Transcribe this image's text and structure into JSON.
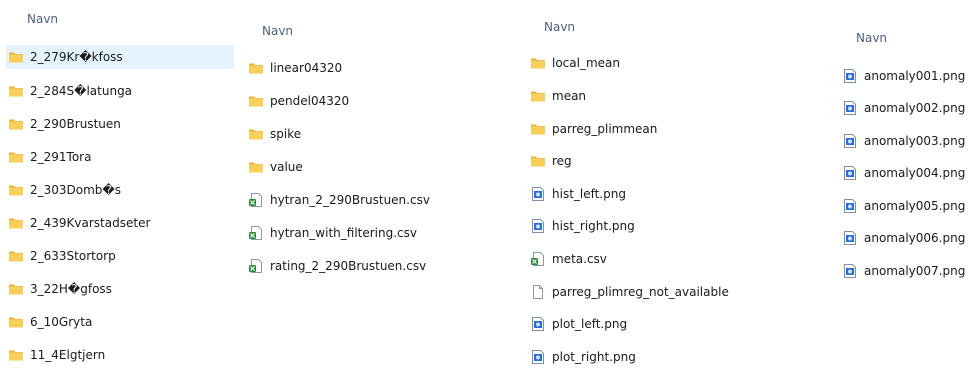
{
  "columns": [
    {
      "header": "Navn",
      "items": [
        {
          "label": "2_279Kr�kfoss",
          "icon": "folder-icon",
          "selected": true
        },
        {
          "label": "2_284S�latunga",
          "icon": "folder-icon"
        },
        {
          "label": "2_290Brustuen",
          "icon": "folder-icon"
        },
        {
          "label": "2_291Tora",
          "icon": "folder-icon"
        },
        {
          "label": "2_303Domb�s",
          "icon": "folder-icon"
        },
        {
          "label": "2_439Kvarstadseter",
          "icon": "folder-icon"
        },
        {
          "label": "2_633Stortorp",
          "icon": "folder-icon"
        },
        {
          "label": "3_22H�gfoss",
          "icon": "folder-icon"
        },
        {
          "label": "6_10Gryta",
          "icon": "folder-icon"
        },
        {
          "label": "11_4Elgtjern",
          "icon": "folder-icon"
        }
      ]
    },
    {
      "header": "Navn",
      "items": [
        {
          "label": "linear04320",
          "icon": "folder-icon"
        },
        {
          "label": "pendel04320",
          "icon": "folder-icon"
        },
        {
          "label": "spike",
          "icon": "folder-icon"
        },
        {
          "label": "value",
          "icon": "folder-icon"
        },
        {
          "label": "hytran_2_290Brustuen.csv",
          "icon": "csv-file-icon"
        },
        {
          "label": "hytran_with_filtering.csv",
          "icon": "csv-file-icon"
        },
        {
          "label": "rating_2_290Brustuen.csv",
          "icon": "csv-file-icon"
        }
      ]
    },
    {
      "header": "Navn",
      "items": [
        {
          "label": "local_mean",
          "icon": "folder-icon"
        },
        {
          "label": "mean",
          "icon": "folder-icon"
        },
        {
          "label": "parreg_plimmean",
          "icon": "folder-icon"
        },
        {
          "label": "reg",
          "icon": "folder-icon"
        },
        {
          "label": "hist_left.png",
          "icon": "png-file-icon"
        },
        {
          "label": "hist_right.png",
          "icon": "png-file-icon"
        },
        {
          "label": "meta.csv",
          "icon": "csv-file-icon"
        },
        {
          "label": "parreg_plimreg_not_available",
          "icon": "blank-file-icon"
        },
        {
          "label": "plot_left.png",
          "icon": "png-file-icon"
        },
        {
          "label": "plot_right.png",
          "icon": "png-file-icon"
        }
      ]
    },
    {
      "header": "Navn",
      "items": [
        {
          "label": "anomaly001.png",
          "icon": "png-file-icon"
        },
        {
          "label": "anomaly002.png",
          "icon": "png-file-icon"
        },
        {
          "label": "anomaly003.png",
          "icon": "png-file-icon"
        },
        {
          "label": "anomaly004.png",
          "icon": "png-file-icon"
        },
        {
          "label": "anomaly005.png",
          "icon": "png-file-icon"
        },
        {
          "label": "anomaly006.png",
          "icon": "png-file-icon"
        },
        {
          "label": "anomaly007.png",
          "icon": "png-file-icon"
        }
      ]
    }
  ],
  "colors": {
    "folder": "#f8cf5a",
    "folder_dark": "#e6b43c",
    "selection": "#e5f3ff",
    "header_text": "#4c607a",
    "csv_green": "#2e8b3a",
    "png_blue": "#2a6fcf"
  }
}
